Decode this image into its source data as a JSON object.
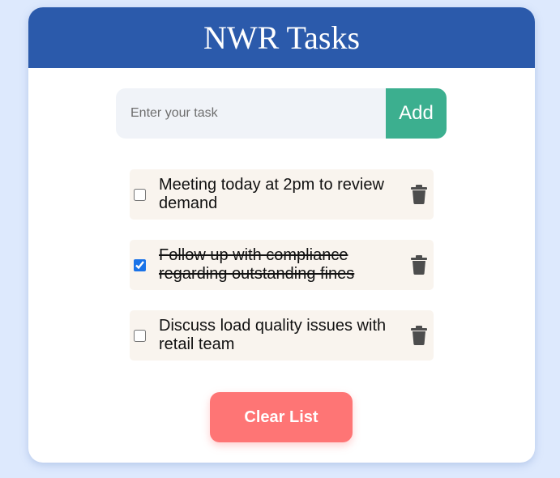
{
  "header": {
    "title": "NWR Tasks"
  },
  "input": {
    "placeholder": "Enter your task",
    "value": "",
    "add_label": "Add"
  },
  "tasks": [
    {
      "text": "Meeting today at 2pm to review demand",
      "completed": false
    },
    {
      "text": "Follow up with compliance regarding outstanding fines",
      "completed": true
    },
    {
      "text": "Discuss load quality issues with retail team",
      "completed": false
    }
  ],
  "actions": {
    "clear_label": "Clear List"
  },
  "icons": {
    "delete": "trash-icon"
  },
  "colors": {
    "header": "#2b5aab",
    "add_button": "#3caf8f",
    "clear_button": "#fe7575",
    "task_background": "#f9f4ee",
    "page_background": "#dde9fd"
  }
}
